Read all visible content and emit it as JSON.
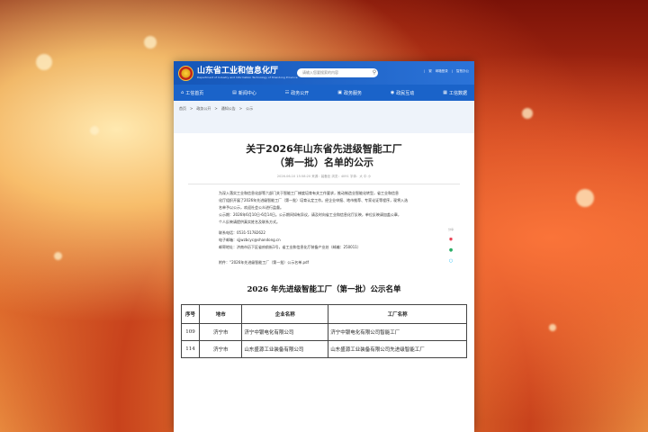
{
  "header": {
    "site_title": "山东省工业和信息化厅",
    "site_subtitle": "Department of Industry and Information Technology of Shandong Province",
    "search_placeholder": "请输入您要搜索的内容",
    "util_links": [
      "|",
      "繁",
      "邮箱登录",
      "|",
      "智慧办公"
    ]
  },
  "nav": {
    "items": [
      {
        "label": "工信首页",
        "icon": "home-icon"
      },
      {
        "label": "新闻中心",
        "icon": "news-icon"
      },
      {
        "label": "政务公开",
        "icon": "document-icon"
      },
      {
        "label": "政务服务",
        "icon": "service-icon"
      },
      {
        "label": "政民互动",
        "icon": "chat-icon"
      },
      {
        "label": "工信数据",
        "icon": "data-icon"
      }
    ]
  },
  "breadcrumb": [
    "首页",
    ">",
    "政务公开",
    ">",
    "通知公告",
    ">",
    "公示"
  ],
  "article": {
    "title_line1": "关于2026年山东省先进级智能工厂",
    "title_line2": "（第一批）名单的公示",
    "meta": "2026-06-10 15:58:20    来源：装备处    浏览：4091    字体：大 中 小",
    "body": [
      "为深入落实工业和信息化部等六部门关于智能工厂梯度培育有关工作要求，推动制造业智能化转型，省工业和信息",
      "化厅组织开展了2026年先进级智能工厂（第一批）培育认定工作。经企业申报、地市推荐、专家论证等程序，现将入选",
      "名单予以公示，欢迎社会公众进行监督。",
      "公示期：2026年6月10日-6月14日。公示期间如有异议，请及时向省工业和信息化厅反映，单位反映请加盖公章，",
      "个人反映请提供真实姓名及联系方式。"
    ],
    "contact": [
      "联系电话：0531-51782622",
      "电子邮箱：sjjwzbcyc@shandong.cn",
      "邮寄地址：济南市历下区省府前街1号，省工业和信息化厅装备产业处（邮编：250011）"
    ],
    "attachment": "附件：“2026年先进级智能工厂（第一批）公示名单.pdf"
  },
  "side_share": {
    "label": "分享",
    "icons": [
      "weibo-icon",
      "wechat-icon",
      "qq-icon"
    ]
  },
  "list": {
    "title": "2026 年先进级智能工厂（第一批）公示名单",
    "headers": [
      "序号",
      "地市",
      "企业名称",
      "工厂名称"
    ],
    "rows": [
      [
        "109",
        "济宁市",
        "济宁中银电化有限公司",
        "济宁中银电化有限公司智能工厂"
      ],
      [
        "114",
        "济宁市",
        "山东盛源工业装备有限公司",
        "山东盛源工业装备有限公司先进级智能工厂"
      ]
    ]
  }
}
